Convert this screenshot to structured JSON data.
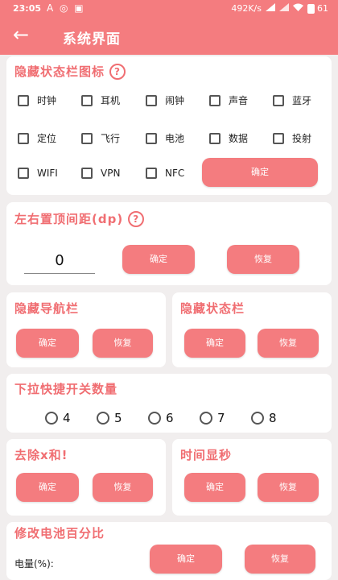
{
  "statusbar": {
    "time": "23:05",
    "notifications": "A ◎ ▣",
    "network_speed": "492K/s",
    "battery": "61"
  },
  "appbar": {
    "title": "系统界面"
  },
  "hide_status_icons": {
    "title": "隐藏状态栏图标",
    "options": [
      "时钟",
      "耳机",
      "闹钟",
      "声音",
      "蓝牙",
      "定位",
      "飞行",
      "电池",
      "数据",
      "投射",
      "WIFI",
      "VPN",
      "NFC"
    ],
    "confirm": "确定"
  },
  "margin": {
    "title": "左右置顶间距(dp)",
    "value": "0",
    "confirm": "确定",
    "restore": "恢复"
  },
  "hide_nav": {
    "title": "隐藏导航栏",
    "confirm": "确定",
    "restore": "恢复"
  },
  "hide_statusbar": {
    "title": "隐藏状态栏",
    "confirm": "确定",
    "restore": "恢复"
  },
  "quick_switch": {
    "title": "下拉快捷开关数量",
    "options": [
      "4",
      "5",
      "6",
      "7",
      "8"
    ]
  },
  "remove_x": {
    "title": "去除x和!",
    "confirm": "确定",
    "restore": "恢复"
  },
  "time_seconds": {
    "title": "时间显秒",
    "confirm": "确定",
    "restore": "恢复"
  },
  "battery_percent": {
    "title": "修改电池百分比",
    "label": "电量(%):",
    "confirm": "确定",
    "restore": "恢复"
  },
  "colors": {
    "accent": "#f47c7f",
    "title_text": "#f06e72",
    "background": "#f1eeee"
  }
}
